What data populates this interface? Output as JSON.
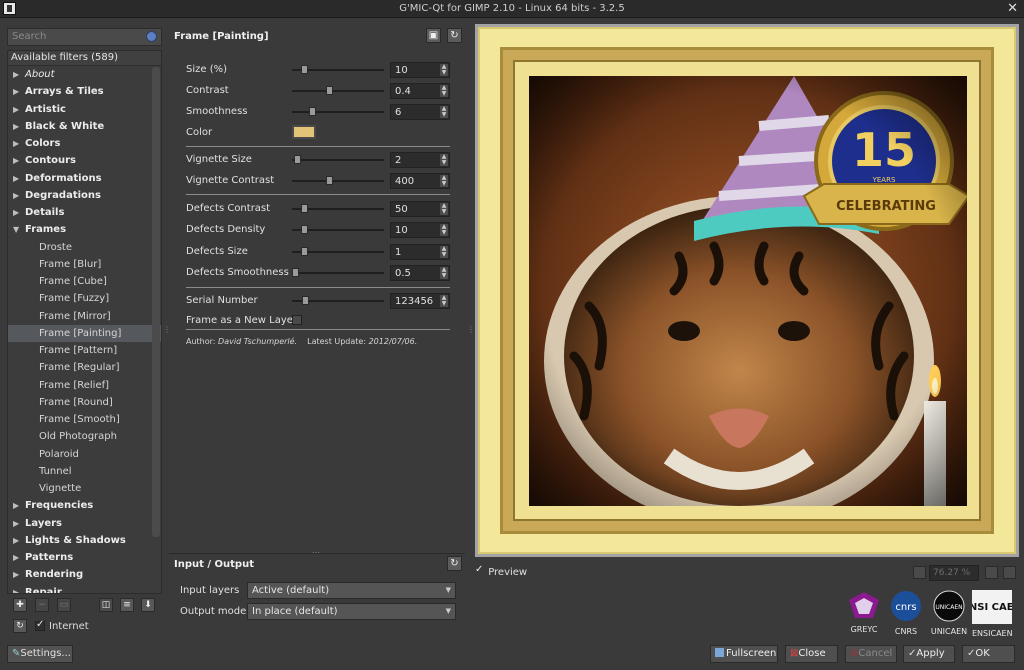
{
  "window": {
    "title": "G'MIC-Qt for GIMP 2.10 - Linux 64 bits - 3.2.5"
  },
  "left": {
    "search_placeholder": "Search",
    "tree_header": "Available filters (589)",
    "items": [
      {
        "label": "About",
        "kind": "cat-italic"
      },
      {
        "label": "Arrays & Tiles",
        "kind": "cat"
      },
      {
        "label": "Artistic",
        "kind": "cat"
      },
      {
        "label": "Black & White",
        "kind": "cat"
      },
      {
        "label": "Colors",
        "kind": "cat"
      },
      {
        "label": "Contours",
        "kind": "cat"
      },
      {
        "label": "Deformations",
        "kind": "cat"
      },
      {
        "label": "Degradations",
        "kind": "cat"
      },
      {
        "label": "Details",
        "kind": "cat"
      },
      {
        "label": "Frames",
        "kind": "cat-open"
      },
      {
        "label": "Droste",
        "kind": "leaf"
      },
      {
        "label": "Frame [Blur]",
        "kind": "leaf"
      },
      {
        "label": "Frame [Cube]",
        "kind": "leaf"
      },
      {
        "label": "Frame [Fuzzy]",
        "kind": "leaf"
      },
      {
        "label": "Frame [Mirror]",
        "kind": "leaf"
      },
      {
        "label": "Frame [Painting]",
        "kind": "leaf-selected"
      },
      {
        "label": "Frame [Pattern]",
        "kind": "leaf"
      },
      {
        "label": "Frame [Regular]",
        "kind": "leaf"
      },
      {
        "label": "Frame [Relief]",
        "kind": "leaf"
      },
      {
        "label": "Frame [Round]",
        "kind": "leaf"
      },
      {
        "label": "Frame [Smooth]",
        "kind": "leaf"
      },
      {
        "label": "Old Photograph",
        "kind": "leaf"
      },
      {
        "label": "Polaroid",
        "kind": "leaf"
      },
      {
        "label": "Tunnel",
        "kind": "leaf"
      },
      {
        "label": "Vignette",
        "kind": "leaf"
      },
      {
        "label": "Frequencies",
        "kind": "cat"
      },
      {
        "label": "Layers",
        "kind": "cat"
      },
      {
        "label": "Lights & Shadows",
        "kind": "cat"
      },
      {
        "label": "Patterns",
        "kind": "cat"
      },
      {
        "label": "Rendering",
        "kind": "cat"
      },
      {
        "label": "Repair",
        "kind": "cat"
      }
    ],
    "internet_label": "Internet",
    "settings_label": "Settings..."
  },
  "filter": {
    "title": "Frame [Painting]",
    "params": [
      {
        "label": "Size (%)",
        "value": "10",
        "level": 0.1
      },
      {
        "label": "Contrast",
        "value": "0.4",
        "level": 0.4
      },
      {
        "label": "Smoothness",
        "value": "6",
        "level": 0.2
      },
      {
        "label": "Vignette Size",
        "value": "2",
        "level": 0.02
      },
      {
        "label": "Vignette Contrast",
        "value": "400",
        "level": 0.4
      },
      {
        "label": "Defects Contrast",
        "value": "50",
        "level": 0.1
      },
      {
        "label": "Defects Density",
        "value": "10",
        "level": 0.1
      },
      {
        "label": "Defects Size",
        "value": "1",
        "level": 0.1
      },
      {
        "label": "Defects Smoothness",
        "value": "0.5",
        "level": 0.0
      },
      {
        "label": "Serial Number",
        "value": "123456",
        "level": 0.12
      }
    ],
    "color_label": "Color",
    "color_value": "#e3c476",
    "new_layer_label": "Frame as a New Layer",
    "author_prefix": "Author:",
    "author": "David Tschumperlé.",
    "update_prefix": "Latest Update:",
    "update": "2012/07/06."
  },
  "io": {
    "title": "Input / Output",
    "input_label": "Input layers",
    "input_value": "Active (default)",
    "output_label": "Output mode",
    "output_value": "In place (default)"
  },
  "preview": {
    "preview_label": "Preview",
    "zoom": "76.27 %",
    "badge_number": "15",
    "badge_sub": "YEARS",
    "badge_ribbon": "CELEBRATING"
  },
  "logos": [
    {
      "label": "GREYC",
      "text": ""
    },
    {
      "label": "CNRS",
      "text": "cnrs"
    },
    {
      "label": "UNICAEN",
      "text": "UNICAEN"
    },
    {
      "label": "ENSICAEN",
      "text": "ENSI CAEN"
    }
  ],
  "buttons": {
    "fullscreen": "Fullscreen",
    "close": "Close",
    "cancel": "Cancel",
    "apply": "Apply",
    "ok": "OK"
  }
}
